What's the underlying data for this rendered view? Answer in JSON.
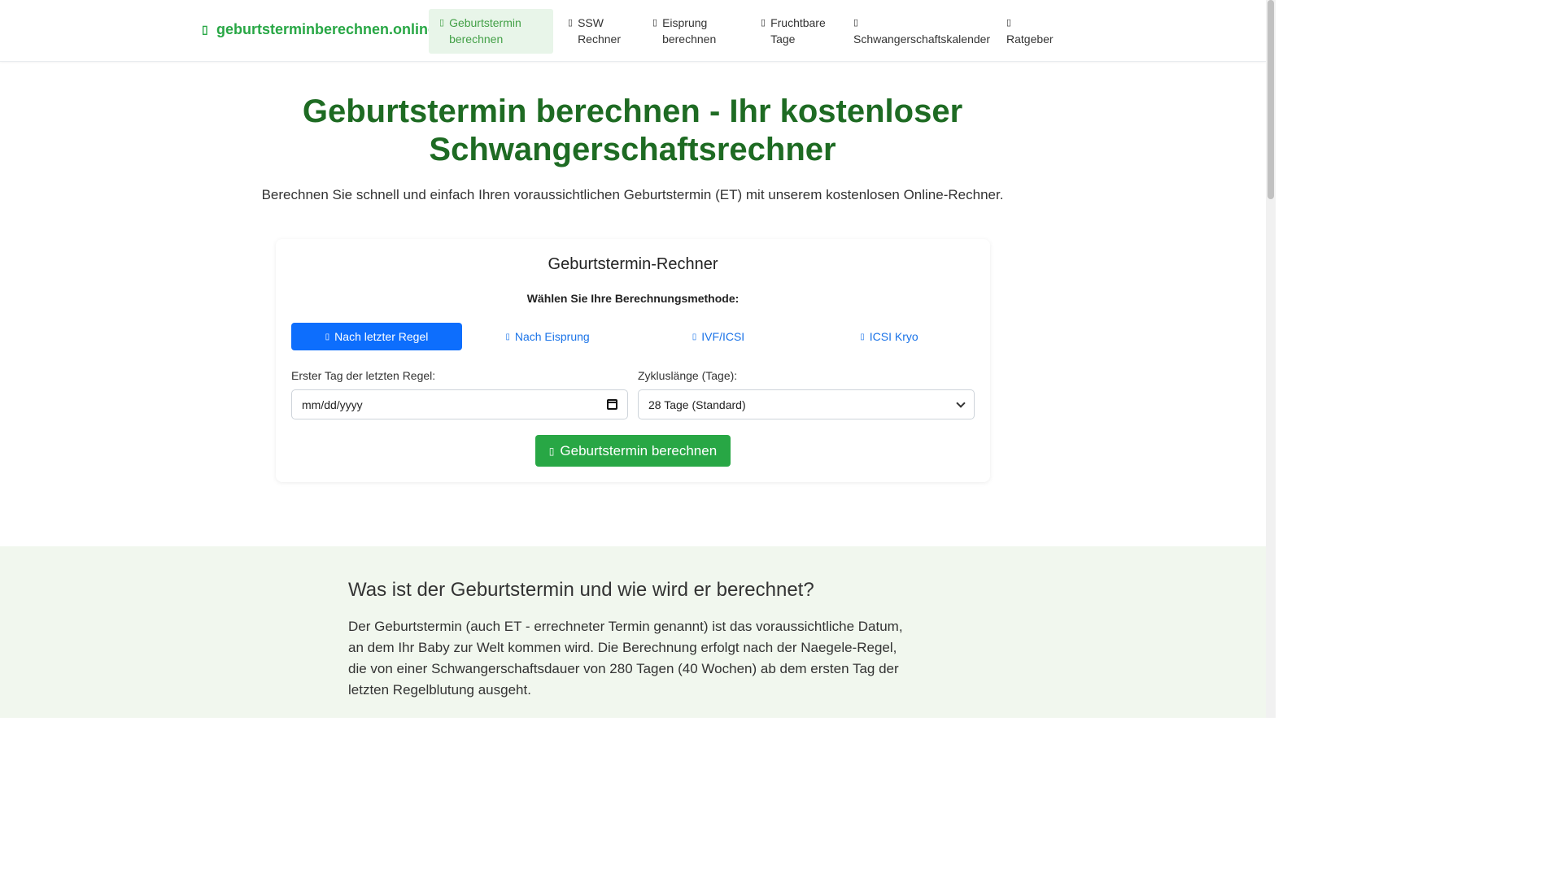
{
  "header": {
    "brand": "geburtsterminberechnen.online",
    "nav": [
      {
        "label": "Geburtstermin berechnen",
        "active": true
      },
      {
        "label": "SSW Rechner"
      },
      {
        "label": "Eisprung berechnen"
      },
      {
        "label": "Fruchtbare Tage"
      },
      {
        "label": "Schwangerschaftskalender"
      },
      {
        "label": "Ratgeber"
      }
    ]
  },
  "hero": {
    "title_line1": "Geburtstermin berechnen - Ihr kostenloser",
    "title_line2": "Schwangerschaftsrechner",
    "subtitle": "Berechnen Sie schnell und einfach Ihren voraussichtlichen Geburtstermin (ET) mit unserem kostenlosen Online-Rechner."
  },
  "calculator": {
    "title": "Geburtstermin-Rechner",
    "method_label": "Wählen Sie Ihre Berechnungsmethode:",
    "methods": [
      {
        "label": "Nach letzter Regel",
        "active": true
      },
      {
        "label": "Nach Eisprung"
      },
      {
        "label": "IVF/ICSI"
      },
      {
        "label": "ICSI Kryo"
      }
    ],
    "date_label": "Erster Tag der letzten Regel:",
    "date_placeholder": "mm/dd/yyyy",
    "cycle_label": "Zykluslänge (Tage):",
    "cycle_value": "28 Tage (Standard)",
    "submit_label": "Geburtstermin berechnen"
  },
  "info": {
    "heading": "Was ist der Geburtstermin und wie wird er berechnet?",
    "text": "Der Geburtstermin (auch ET - errechneter Termin genannt) ist das voraussichtliche Datum, an dem Ihr Baby zur Welt kommen wird. Die Berechnung erfolgt nach der Naegele-Regel, die von einer Schwangerschaftsdauer von 280 Tagen (40 Wochen) ab dem ersten Tag der letzten Regelblutung ausgeht."
  },
  "colors": {
    "brand_green": "#28a745",
    "title_green": "#1e6b23",
    "primary_blue": "#0d6efd",
    "info_bg": "#f1f7ee"
  }
}
